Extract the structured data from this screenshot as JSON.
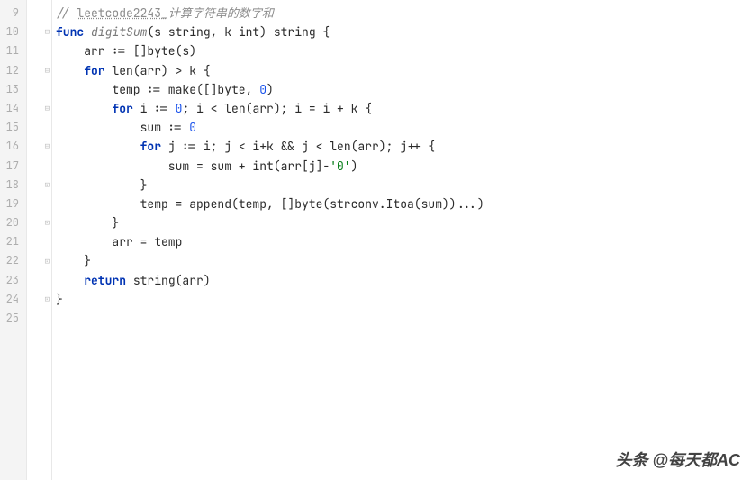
{
  "lines": [
    {
      "n": 9,
      "fold": "",
      "tokens": [
        [
          "comment",
          "// "
        ],
        [
          "comment-link",
          "leetcode2243_"
        ],
        [
          "comment",
          "计算字符串的数字和"
        ]
      ]
    },
    {
      "n": 10,
      "fold": "⊟",
      "tokens": [
        [
          "kw",
          "func"
        ],
        [
          "ident",
          " "
        ],
        [
          "fn",
          "digitSum"
        ],
        [
          "ident",
          "(s string, k int) string {"
        ]
      ]
    },
    {
      "n": 11,
      "fold": "",
      "tokens": [
        [
          "ident",
          "    arr := []byte(s)"
        ]
      ]
    },
    {
      "n": 12,
      "fold": "⊟",
      "tokens": [
        [
          "ident",
          "    "
        ],
        [
          "kw",
          "for"
        ],
        [
          "ident",
          " len(arr) > k {"
        ]
      ]
    },
    {
      "n": 13,
      "fold": "",
      "tokens": [
        [
          "ident",
          "        temp := make([]byte, "
        ],
        [
          "num",
          "0"
        ],
        [
          "ident",
          ")"
        ]
      ]
    },
    {
      "n": 14,
      "fold": "⊟",
      "tokens": [
        [
          "ident",
          "        "
        ],
        [
          "kw",
          "for"
        ],
        [
          "ident",
          " i := "
        ],
        [
          "num",
          "0"
        ],
        [
          "ident",
          "; i < len(arr); i = i + k {"
        ]
      ]
    },
    {
      "n": 15,
      "fold": "",
      "tokens": [
        [
          "ident",
          "            sum := "
        ],
        [
          "num",
          "0"
        ]
      ]
    },
    {
      "n": 16,
      "fold": "⊟",
      "tokens": [
        [
          "ident",
          "            "
        ],
        [
          "kw",
          "for"
        ],
        [
          "ident",
          " j := i; j < i+k && j < len(arr); j++ {"
        ]
      ]
    },
    {
      "n": 17,
      "fold": "",
      "tokens": [
        [
          "ident",
          "                sum = sum + int(arr[j]-"
        ],
        [
          "str",
          "'0'"
        ],
        [
          "ident",
          ")"
        ]
      ]
    },
    {
      "n": 18,
      "fold": "⊡",
      "tokens": [
        [
          "ident",
          "            }"
        ]
      ]
    },
    {
      "n": 19,
      "fold": "",
      "tokens": [
        [
          "ident",
          "            temp = append(temp, []byte(strconv.Itoa(sum))...)"
        ]
      ]
    },
    {
      "n": 20,
      "fold": "⊡",
      "tokens": [
        [
          "ident",
          "        }"
        ]
      ]
    },
    {
      "n": 21,
      "fold": "",
      "tokens": [
        [
          "ident",
          "        arr = temp"
        ]
      ]
    },
    {
      "n": 22,
      "fold": "⊡",
      "tokens": [
        [
          "ident",
          "    }"
        ]
      ]
    },
    {
      "n": 23,
      "fold": "",
      "tokens": [
        [
          "ident",
          "    "
        ],
        [
          "kw",
          "return"
        ],
        [
          "ident",
          " string(arr)"
        ]
      ]
    },
    {
      "n": 24,
      "fold": "⊡",
      "tokens": [
        [
          "ident",
          "}"
        ]
      ]
    },
    {
      "n": 25,
      "fold": "",
      "tokens": []
    }
  ],
  "watermark": "头条 @每天都AC"
}
